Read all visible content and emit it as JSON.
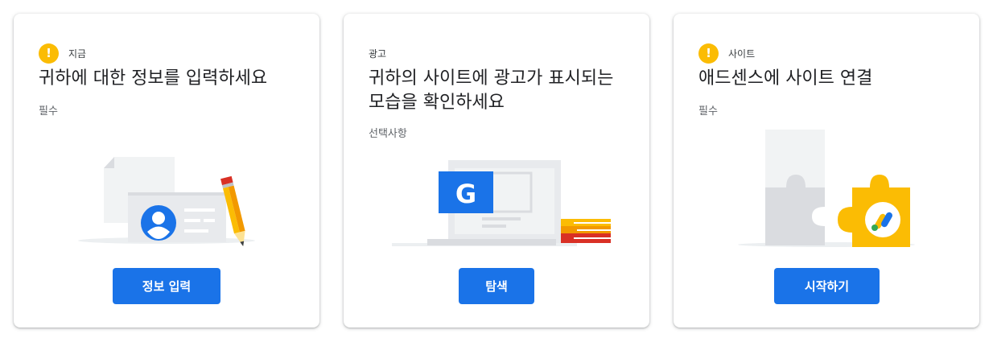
{
  "cards": [
    {
      "eyebrow": "지금",
      "warning_icon": "!",
      "title": "귀하에 대한 정보를 입력하세요",
      "subtitle": "필수",
      "button": "정보 입력",
      "illustration": "profile-card-with-pencil"
    },
    {
      "eyebrow": "광고",
      "title": "귀하의 사이트에 광고가 표시되는 모습을 확인하세요",
      "subtitle": "선택사항",
      "button": "탐색",
      "illustration": "laptop-with-google-ad-and-books",
      "ad_letter": "G"
    },
    {
      "eyebrow": "사이트",
      "warning_icon": "!",
      "title": "애드센스에 사이트 연결",
      "subtitle": "필수",
      "button": "시작하기",
      "illustration": "puzzle-pieces-with-adsense-logo"
    }
  ],
  "colors": {
    "accent": "#1a73e8",
    "warning": "#fbbc04",
    "card_shadow": "#dadce0"
  }
}
